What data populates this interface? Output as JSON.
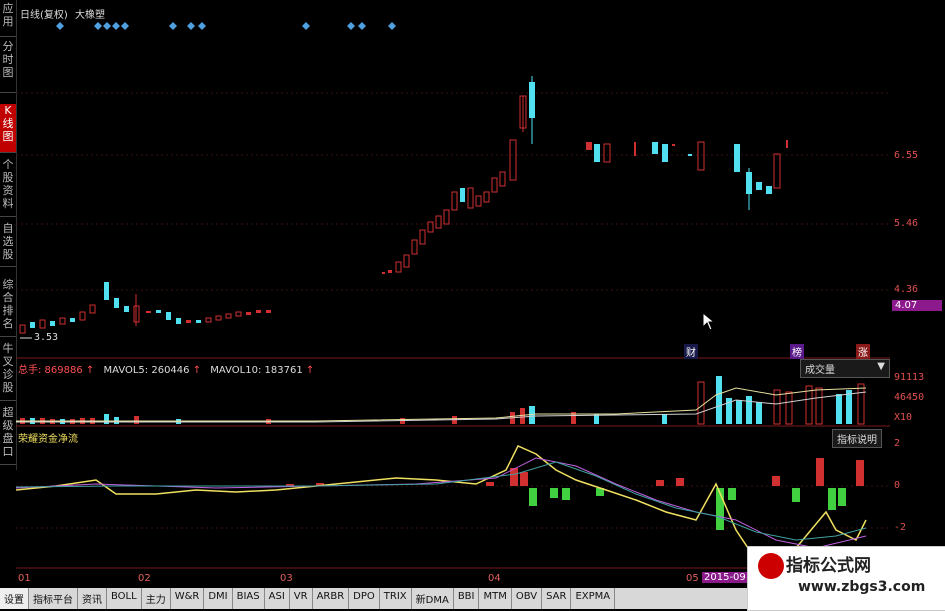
{
  "sidebar": {
    "items": [
      {
        "label": "应用"
      },
      {
        "label": "分时图"
      },
      {
        "label": "K线图"
      },
      {
        "label": "个股资料"
      },
      {
        "label": "自选股"
      },
      {
        "label": "综合排名"
      },
      {
        "label": "牛叉诊股"
      },
      {
        "label": "超级盘口"
      }
    ]
  },
  "header": {
    "period": "日线(复权)",
    "name": "大橡塑"
  },
  "price_axis": {
    "labels": [
      "6.55",
      "5.46",
      "4.36"
    ],
    "current": "4.07",
    "low_mark": "3.53"
  },
  "event_tags": [
    "财",
    "榜",
    "涨"
  ],
  "volume_panel": {
    "total_label": "总手: 869886",
    "ma5_label": "MAVOL5: 260446",
    "ma10_label": "MAVOL10: 183761",
    "selector": "成交量",
    "axis": [
      "91113",
      "46450",
      "X10"
    ]
  },
  "indicator_panel": {
    "name": "荣耀资金净流",
    "help": "指标说明",
    "axis": [
      "2",
      "0",
      "-2"
    ]
  },
  "x_axis": {
    "labels": [
      "01",
      "02",
      "03",
      "04",
      "05"
    ],
    "highlight": "2015-09"
  },
  "tabs": [
    "设置",
    "指标平台",
    "资讯",
    "BOLL",
    "主力",
    "W&R",
    "DMI",
    "BIAS",
    "ASI",
    "VR",
    "ARBR",
    "DPO",
    "TRIX",
    "新DMA",
    "BBI",
    "MTM",
    "OBV",
    "SAR",
    "EXPMA"
  ],
  "watermark": {
    "title": "指标公式网",
    "url": "www.zbgs3.com"
  },
  "colors": {
    "up": "#d03030",
    "down": "#50e0f0",
    "accent": "#8c1a8c"
  },
  "chart_data": {
    "type": "candlestick",
    "note_series": [
      {
        "name": "MAVOL5",
        "value": 260446
      },
      {
        "name": "MAVOL10",
        "value": 183761
      }
    ]
  }
}
